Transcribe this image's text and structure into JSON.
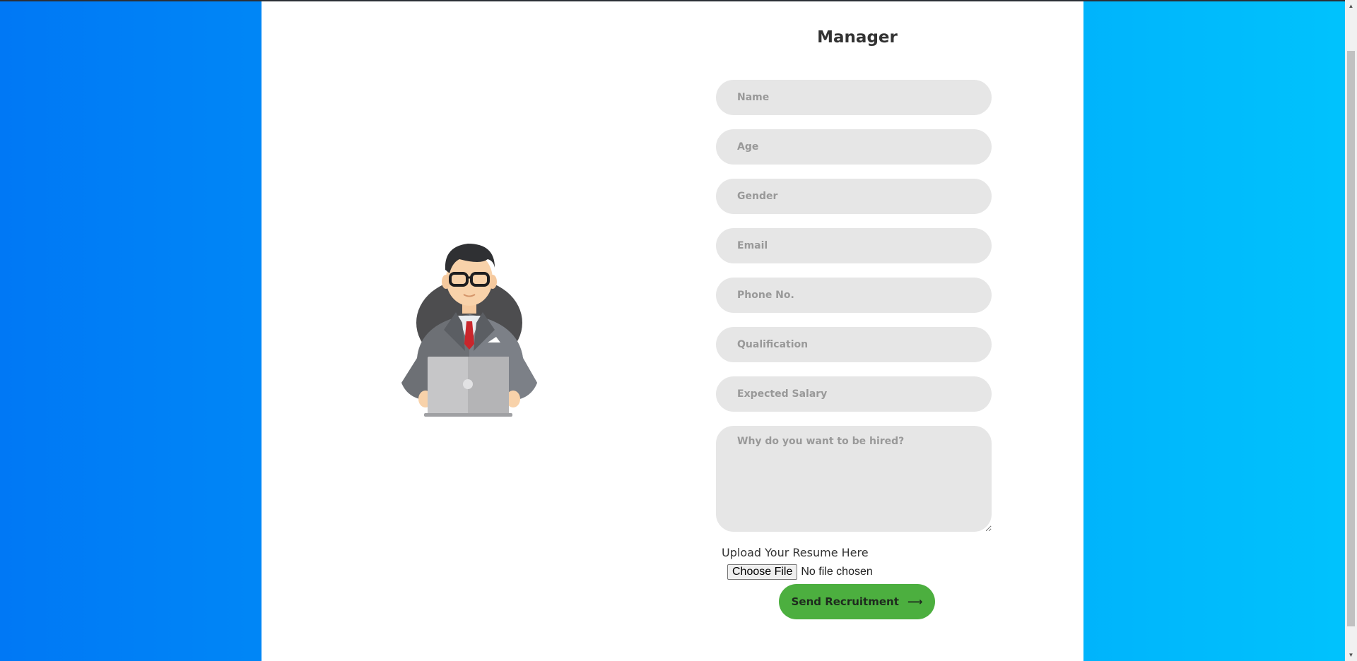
{
  "form": {
    "title": "Manager",
    "fields": [
      {
        "placeholder": "Name"
      },
      {
        "placeholder": "Age"
      },
      {
        "placeholder": "Gender"
      },
      {
        "placeholder": "Email"
      },
      {
        "placeholder": "Phone No."
      },
      {
        "placeholder": "Qualification"
      },
      {
        "placeholder": "Expected Salary"
      }
    ],
    "reason_placeholder": "Why do you want to be hired?",
    "upload_label": "Upload Your Resume Here",
    "choose_file_label": "Choose File",
    "no_file_text": "No file chosen",
    "submit_label": "Send Recruitment",
    "submit_icon": "arrow-right-icon",
    "submit_arrow": "⟶"
  },
  "illustration": {
    "icon": "businessman-with-laptop"
  },
  "colors": {
    "background_left": "#0078f5",
    "background_right": "#00c3fd",
    "card": "#ffffff",
    "field": "#e6e6e6",
    "submit": "#4caf3f"
  }
}
